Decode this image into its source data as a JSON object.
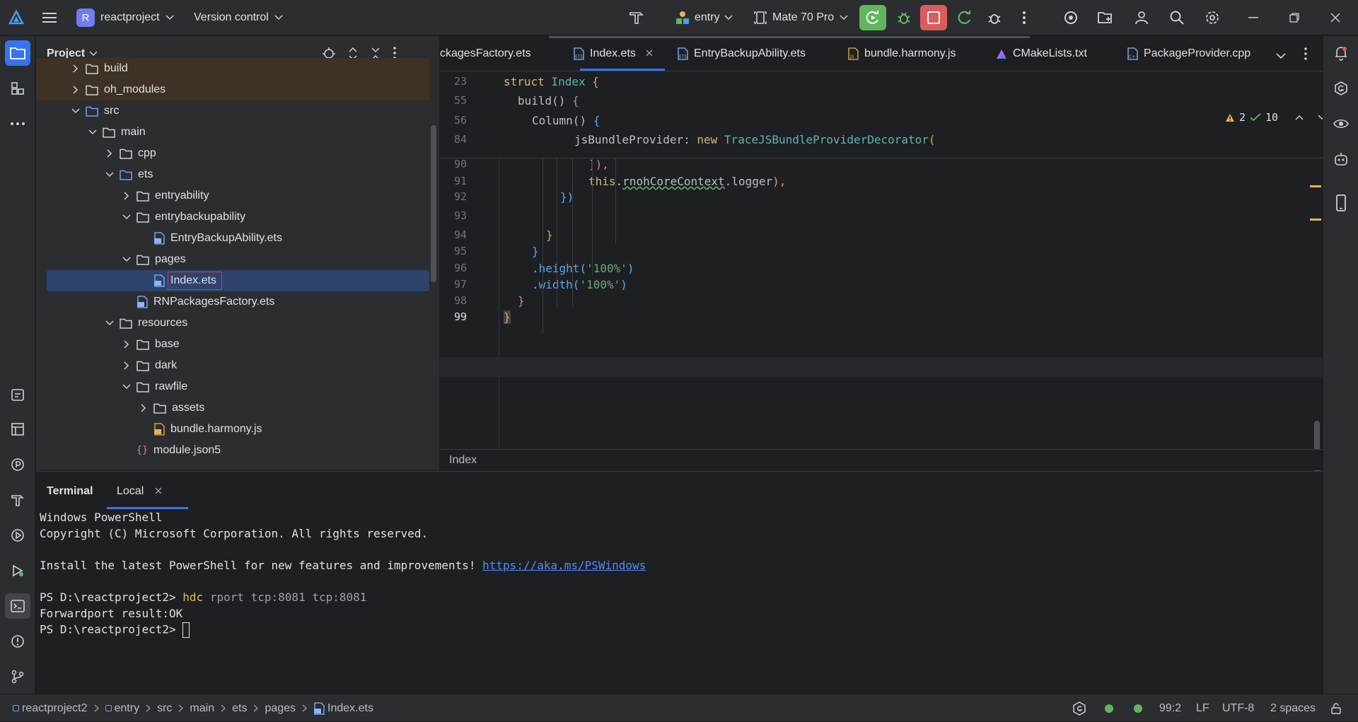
{
  "titlebar": {
    "project_initial": "R",
    "project_name": "reactproject",
    "vcs_label": "Version control",
    "run_config": "entry",
    "device": "Mate 70 Pro"
  },
  "project_panel": {
    "title": "Project",
    "tree": [
      {
        "label": "build",
        "type": "folder",
        "expanded": false
      },
      {
        "label": "oh_modules",
        "type": "folder",
        "expanded": false
      },
      {
        "label": "src",
        "type": "folder",
        "expanded": true
      },
      {
        "label": "main",
        "type": "folder",
        "expanded": true
      },
      {
        "label": "cpp",
        "type": "folder",
        "expanded": false
      },
      {
        "label": "ets",
        "type": "folder",
        "expanded": true
      },
      {
        "label": "entryability",
        "type": "folder",
        "expanded": false
      },
      {
        "label": "entrybackupability",
        "type": "folder",
        "expanded": true
      },
      {
        "label": "EntryBackupAbility.ets",
        "type": "file"
      },
      {
        "label": "pages",
        "type": "folder",
        "expanded": true
      },
      {
        "label": "Index.ets",
        "type": "file",
        "selected": true
      },
      {
        "label": "RNPackagesFactory.ets",
        "type": "file"
      },
      {
        "label": "resources",
        "type": "folder",
        "expanded": true
      },
      {
        "label": "base",
        "type": "folder",
        "expanded": false
      },
      {
        "label": "dark",
        "type": "folder",
        "expanded": false
      },
      {
        "label": "rawfile",
        "type": "folder",
        "expanded": true
      },
      {
        "label": "assets",
        "type": "folder",
        "expanded": false
      },
      {
        "label": "bundle.harmony.js",
        "type": "file"
      },
      {
        "label": "module.json5",
        "type": "json"
      }
    ]
  },
  "editor": {
    "tabs": [
      {
        "label": "ckagesFactory.ets"
      },
      {
        "label": "Index.ets",
        "active": true
      },
      {
        "label": "EntryBackupAbility.ets"
      },
      {
        "label": "bundle.harmony.js"
      },
      {
        "label": "CMakeLists.txt"
      },
      {
        "label": "PackageProvider.cpp"
      }
    ],
    "warnings": "2",
    "weak_warnings": "10",
    "sticky_lines": [
      {
        "no": "23",
        "indent": 0,
        "tokens": [
          {
            "t": "struct ",
            "c": "kw2"
          },
          {
            "t": "Index ",
            "c": "ty"
          },
          {
            "t": "{",
            "c": "br1"
          }
        ]
      },
      {
        "no": "55",
        "indent": 1,
        "tokens": [
          {
            "t": "build",
            "c": ""
          },
          {
            "t": "() ",
            "c": ""
          },
          {
            "t": "{",
            "c": "br2"
          }
        ]
      },
      {
        "no": "56",
        "indent": 2,
        "tokens": [
          {
            "t": "Column",
            "c": ""
          },
          {
            "t": "() ",
            "c": ""
          },
          {
            "t": "{",
            "c": "br3"
          }
        ]
      },
      {
        "no": "84",
        "indent": 5,
        "tokens": [
          {
            "t": "jsBundleProvider: ",
            "c": ""
          },
          {
            "t": "new ",
            "c": "kw2"
          },
          {
            "t": "TraceJSBundleProviderDecorator",
            "c": "ty"
          },
          {
            "t": "(",
            "c": "br1"
          }
        ]
      }
    ],
    "lines": [
      {
        "no": "90",
        "indent": 6,
        "tokens": [
          {
            "t": "]),",
            "c": "br2"
          }
        ]
      },
      {
        "no": "91",
        "indent": 6,
        "tokens": [
          {
            "t": "this",
            "c": "kw2"
          },
          {
            "t": ".",
            "c": ""
          },
          {
            "t": "rnohCoreContext",
            "c": ""
          },
          {
            "t": ".logger",
            "c": ""
          },
          {
            "t": "),",
            "c": "br1"
          }
        ]
      },
      {
        "no": "92",
        "indent": 4,
        "tokens": [
          {
            "t": "})",
            "c": "br3"
          }
        ]
      },
      {
        "no": "93",
        "indent": 0,
        "tokens": []
      },
      {
        "no": "94",
        "indent": 3,
        "tokens": [
          {
            "t": "}",
            "c": "br1"
          }
        ]
      },
      {
        "no": "95",
        "indent": 2,
        "tokens": [
          {
            "t": "}",
            "c": "br3"
          }
        ]
      },
      {
        "no": "96",
        "indent": 2,
        "tokens": [
          {
            "t": ".height",
            "c": "fn"
          },
          {
            "t": "(",
            "c": "br3"
          },
          {
            "t": "'100%'",
            "c": "str"
          },
          {
            "t": ")",
            "c": "br3"
          }
        ]
      },
      {
        "no": "97",
        "indent": 2,
        "tokens": [
          {
            "t": ".width",
            "c": "fn"
          },
          {
            "t": "(",
            "c": "br3"
          },
          {
            "t": "'100%'",
            "c": "str"
          },
          {
            "t": ")",
            "c": "br3"
          }
        ]
      },
      {
        "no": "98",
        "indent": 1,
        "tokens": [
          {
            "t": "}",
            "c": "br2"
          }
        ]
      },
      {
        "no": "99",
        "indent": 0,
        "tokens": [
          {
            "t": "}",
            "c": "br1"
          }
        ]
      }
    ],
    "breadcrumb": "Index"
  },
  "terminal": {
    "title": "Terminal",
    "tab_label": "Local",
    "lines": [
      {
        "text": "Windows PowerShell"
      },
      {
        "text": "Copyright (C) Microsoft Corporation. All rights reserved."
      },
      {
        "text": ""
      },
      {
        "text": "Install the latest PowerShell for new features and improvements! ",
        "link": "https://aka.ms/PSWindows"
      },
      {
        "text": ""
      },
      {
        "prompt": "PS D:\\reactproject2> ",
        "cmd": "hdc",
        "args": " rport tcp:8081 tcp:8081"
      },
      {
        "text": "Forwardport result:OK"
      },
      {
        "prompt": "PS D:\\reactproject2> ",
        "cursor": true
      }
    ]
  },
  "statusbar": {
    "path": [
      "reactproject2",
      "entry",
      "src",
      "main",
      "ets",
      "pages",
      "Index.ets"
    ],
    "position": "99:2",
    "line_sep": "LF",
    "encoding": "UTF-8",
    "indent": "2 spaces"
  },
  "colors": {
    "accent": "#3574f0",
    "run_green": "#5fb65b",
    "stop_red": "#db5c5c",
    "selected_row": "#2e436e",
    "excluded_folder_bg": "#3d3223"
  }
}
